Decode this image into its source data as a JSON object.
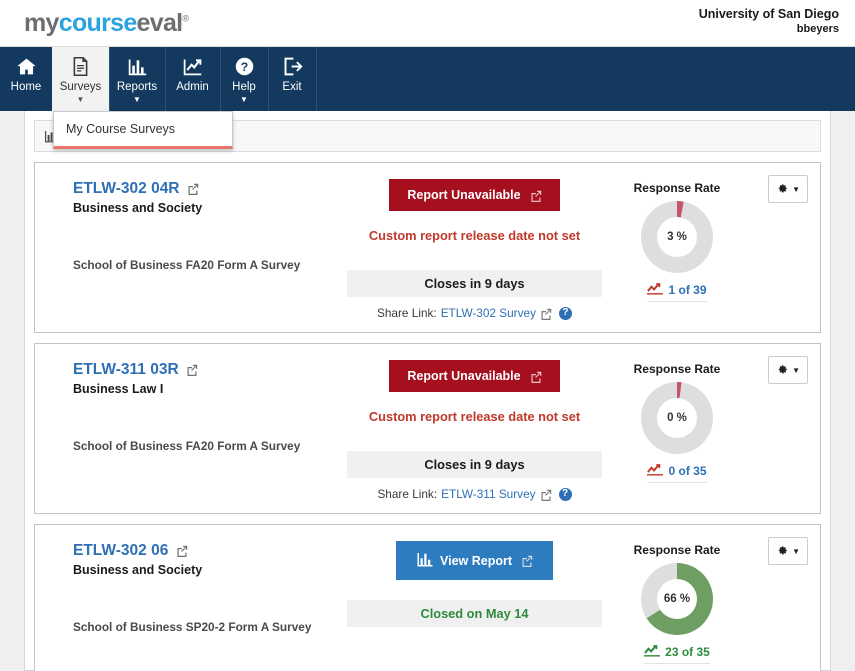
{
  "header": {
    "logo_my": "my",
    "logo_course": "course",
    "logo_eval": "eval",
    "logo_tm": "®",
    "university": "University of San Diego",
    "username": "bbeyers"
  },
  "nav": {
    "items": [
      {
        "label": "Home",
        "icon": "home-icon",
        "caret": "",
        "active": false
      },
      {
        "label": "Surveys",
        "icon": "document-icon",
        "caret": "▼",
        "active": true
      },
      {
        "label": "Reports",
        "icon": "bar-chart-icon",
        "caret": "▼",
        "active": false
      },
      {
        "label": "Admin",
        "icon": "trend-line-icon",
        "caret": "",
        "active": false
      },
      {
        "label": "Help",
        "icon": "question-icon",
        "caret": "▼",
        "active": false
      },
      {
        "label": "Exit",
        "icon": "exit-icon",
        "caret": "",
        "active": false
      }
    ]
  },
  "dropdown": {
    "open": true,
    "items": [
      {
        "label": "My Course Surveys"
      }
    ]
  },
  "toolbar": {
    "icon": "bar-chart-icon"
  },
  "cards": [
    {
      "code": "ETLW-302 04R",
      "title": "Business and Society",
      "form": "School of Business FA20 Form A Survey",
      "button_label": "Report Unavailable",
      "button_style": "unavailable",
      "button_icon": "external-link-icon",
      "note": "Custom report release date not set",
      "status": "Closes in 9 days",
      "status_style": "dark",
      "share_label": "Share Link:",
      "share_link": "ETLW-302 Survey",
      "help_icon": "question-circle-icon",
      "response_rate_label": "Response Rate",
      "percent_text": "3 %",
      "percent_value": 3,
      "count_text": "1 of 39",
      "count_style": "blue",
      "arc_color": "#c4536e",
      "track_color": "#dedede",
      "gear_icon": "gear-icon"
    },
    {
      "code": "ETLW-311 03R",
      "title": "Business Law I",
      "form": "School of Business FA20 Form A Survey",
      "button_label": "Report Unavailable",
      "button_style": "unavailable",
      "button_icon": "external-link-icon",
      "note": "Custom report release date not set",
      "status": "Closes in 9 days",
      "status_style": "dark",
      "share_label": "Share Link:",
      "share_link": "ETLW-311 Survey",
      "help_icon": "question-circle-icon",
      "response_rate_label": "Response Rate",
      "percent_text": "0 %",
      "percent_value": 2,
      "count_text": "0 of 35",
      "count_style": "blue",
      "arc_color": "#c4536e",
      "track_color": "#dedede",
      "gear_icon": "gear-icon"
    },
    {
      "code": "ETLW-302 06",
      "title": "Business and Society",
      "form": "School of Business SP20-2 Form A Survey",
      "button_label": "View Report",
      "button_style": "view",
      "button_icon": "external-link-icon",
      "button_lead_icon": "bar-chart-icon",
      "note": "",
      "status": "Closed on May 14",
      "status_style": "green",
      "share_label": "",
      "share_link": "",
      "response_rate_label": "Response Rate",
      "percent_text": "66 %",
      "percent_value": 66,
      "count_text": "23 of 35",
      "count_style": "green",
      "arc_color": "#6f9e62",
      "track_color": "#dedede",
      "gear_icon": "gear-icon"
    }
  ],
  "colors": {
    "navy": "#133a5e",
    "brand_blue": "#2ba3dd",
    "link_blue": "#2f6fb5",
    "danger_red": "#a50f1e",
    "note_red": "#c0392b",
    "success_green": "#2e8b3d",
    "page_bg": "#efefef"
  }
}
